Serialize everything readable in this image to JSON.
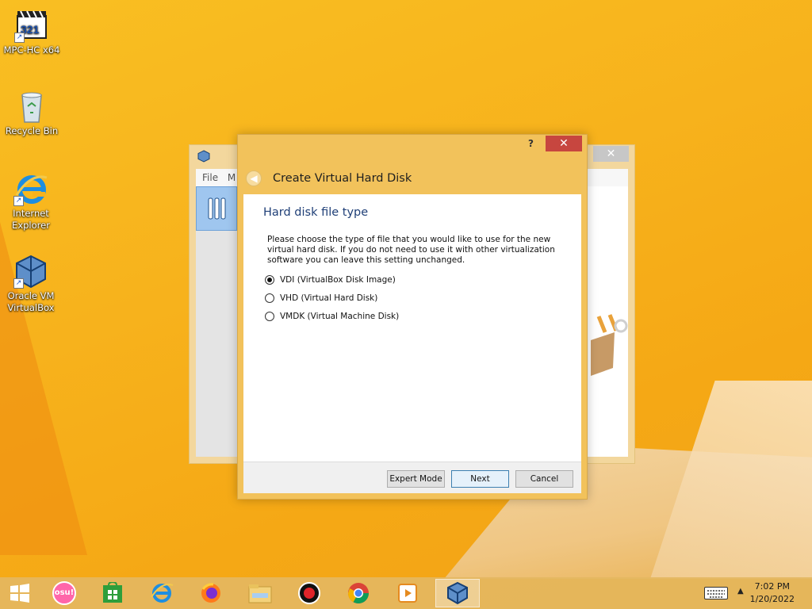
{
  "desktop": {
    "icons": [
      {
        "label": "MPC-HC x64"
      },
      {
        "label": "Recycle Bin"
      },
      {
        "label": "Internet Explorer"
      },
      {
        "label": "Oracle VM VirtualBox"
      }
    ]
  },
  "background_window": {
    "menu_file": "File",
    "menu_machine": "M",
    "close_glyph": "✕"
  },
  "dialog": {
    "help_glyph": "?",
    "close_glyph": "✕",
    "back_glyph": "◀",
    "title": "Create Virtual Hard Disk",
    "page_heading": "Hard disk file type",
    "description": "Please choose the type of file that you would like to use for the new virtual hard disk. If you do not need to use it with other virtualization software you can leave this setting unchanged.",
    "options": [
      {
        "label": "VDI (VirtualBox Disk Image)",
        "checked": true
      },
      {
        "label": "VHD (Virtual Hard Disk)",
        "checked": false
      },
      {
        "label": "VMDK (Virtual Machine Disk)",
        "checked": false
      }
    ],
    "buttons": {
      "expert": "Expert Mode",
      "next": "Next",
      "cancel": "Cancel"
    }
  },
  "taskbar": {
    "items": [
      "start",
      "osu",
      "store",
      "internet-explorer",
      "firefox",
      "file-explorer",
      "recorder",
      "chrome",
      "media-player",
      "virtualbox"
    ],
    "osu_label": "osu!",
    "time": "7:02 PM",
    "date": "1/20/2022"
  },
  "colors": {
    "dialog_frame": "#f2c25b",
    "close_button": "#c7463f",
    "heading_text": "#1f3f77"
  }
}
